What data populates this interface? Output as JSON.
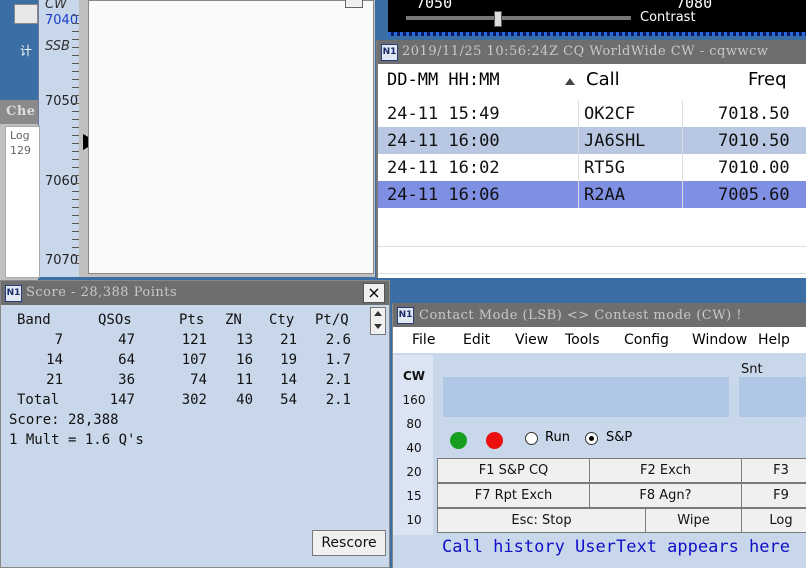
{
  "bandmap": {
    "mode_cw": "CW",
    "mode_ssb": "SSB",
    "freq_labels": [
      "7040",
      "7050",
      "7060",
      "7070"
    ]
  },
  "waterfall": {
    "freq_left": "7050",
    "freq_right": "7080",
    "contrast_label": "Contrast",
    "contrast_level": 0.3
  },
  "desktop": {
    "icon_label": "计"
  },
  "check_window": {
    "title": "Che",
    "line1": "Log",
    "line2": "129"
  },
  "dx_window": {
    "title": "2019/11/25 10:56:24Z  CQ WorldWide CW - cqwwcw",
    "col_time": "DD-MM HH:MM",
    "col_call": "Call",
    "col_freq": "Freq",
    "rows": [
      {
        "time": "24-11 15:49",
        "call": "OK2CF",
        "freq": "7018.50"
      },
      {
        "time": "24-11 16:00",
        "call": "JA6SHL",
        "freq": "7010.50"
      },
      {
        "time": "24-11 16:02",
        "call": "RT5G",
        "freq": "7010.00"
      },
      {
        "time": "24-11 16:06",
        "call": "R2AA",
        "freq": "7005.60"
      }
    ]
  },
  "score_window": {
    "title": "Score - 28,388 Points",
    "headers": [
      "Band",
      "QSOs",
      "Pts",
      "ZN",
      "Cty",
      "Pt/Q"
    ],
    "rows": [
      [
        "7",
        "47",
        "121",
        "13",
        "21",
        "2.6"
      ],
      [
        "14",
        "64",
        "107",
        "16",
        "19",
        "1.7"
      ],
      [
        "21",
        "36",
        "74",
        "11",
        "14",
        "2.1"
      ],
      [
        "Total",
        "147",
        "302",
        "40",
        "54",
        "2.1"
      ]
    ],
    "score_line": "Score: 28,388",
    "mult_line": "1 Mult = 1.6 Q's",
    "rescore_label": "Rescore",
    "close_label": "×"
  },
  "entry_window": {
    "title": "Contact Mode (LSB) <> Contest mode (CW) !",
    "menu": [
      "File",
      "Edit",
      "View",
      "Tools",
      "Config",
      "Window",
      "Help"
    ],
    "mode_label": "CW",
    "bands": [
      "160",
      "80",
      "40",
      "20",
      "15",
      "10"
    ],
    "snt_label": "Snt",
    "run_label": "Run",
    "sp_label": "S&P",
    "fkeys_row1": [
      "F1 S&P CQ",
      "F2 Exch",
      "F3"
    ],
    "fkeys_row2": [
      "F7 Rpt Exch",
      "F8 Agn?",
      "F9"
    ],
    "fkeys_row3": [
      "Esc: Stop",
      "Wipe",
      "Log"
    ],
    "status_text": "Call history UserText appears here"
  },
  "colors": {
    "desktop": "#3a6ea5",
    "title_bar": "#6b6b6b",
    "panel": "#c9d7ea",
    "highlight": "#7f8fe4",
    "alt_row": "#b8c8e2",
    "status_text": "#1010c8"
  }
}
